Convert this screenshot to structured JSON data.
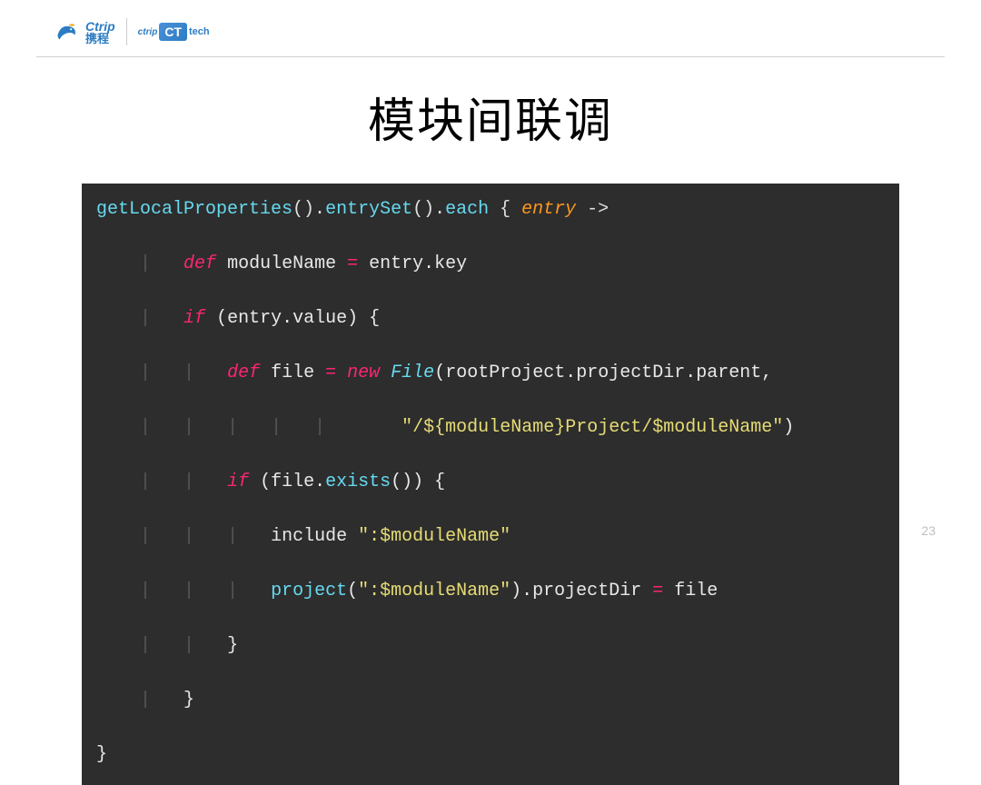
{
  "header": {
    "logo_en": "Ctrip",
    "logo_cn": "携程",
    "tech_small": "ctrip",
    "tech_box": "CT",
    "tech_label": "tech"
  },
  "title": "模块间联调",
  "code": {
    "line1": {
      "a": "getLocalProperties",
      "b": "().",
      "c": "entrySet",
      "d": "().",
      "e": "each",
      "f": " { ",
      "g": "entry",
      "h": " ->"
    },
    "line2": {
      "a": "def",
      "b": " moduleName ",
      "c": "=",
      "d": " entry.key"
    },
    "line3": {
      "a": "if",
      "b": " (entry.value) {"
    },
    "line4": {
      "a": "def",
      "b": " file ",
      "c": "=",
      "d": " ",
      "e": "new",
      "f": " ",
      "g": "File",
      "h": "(rootProject.projectDir.parent,"
    },
    "line5": {
      "a": "\"/${moduleName}Project/$moduleName\"",
      "b": ")"
    },
    "line6": {
      "a": "if",
      "b": " (file.",
      "c": "exists",
      "d": "()) {"
    },
    "line7": {
      "a": "include ",
      "b": "\":$moduleName\""
    },
    "line8": {
      "a": "project",
      "b": "(",
      "c": "\":$moduleName\"",
      "d": ").projectDir ",
      "e": "=",
      "f": " file"
    },
    "line9": {
      "a": "}"
    },
    "line10": {
      "a": "}"
    },
    "line11": {
      "a": "}"
    }
  },
  "page_number": "23"
}
